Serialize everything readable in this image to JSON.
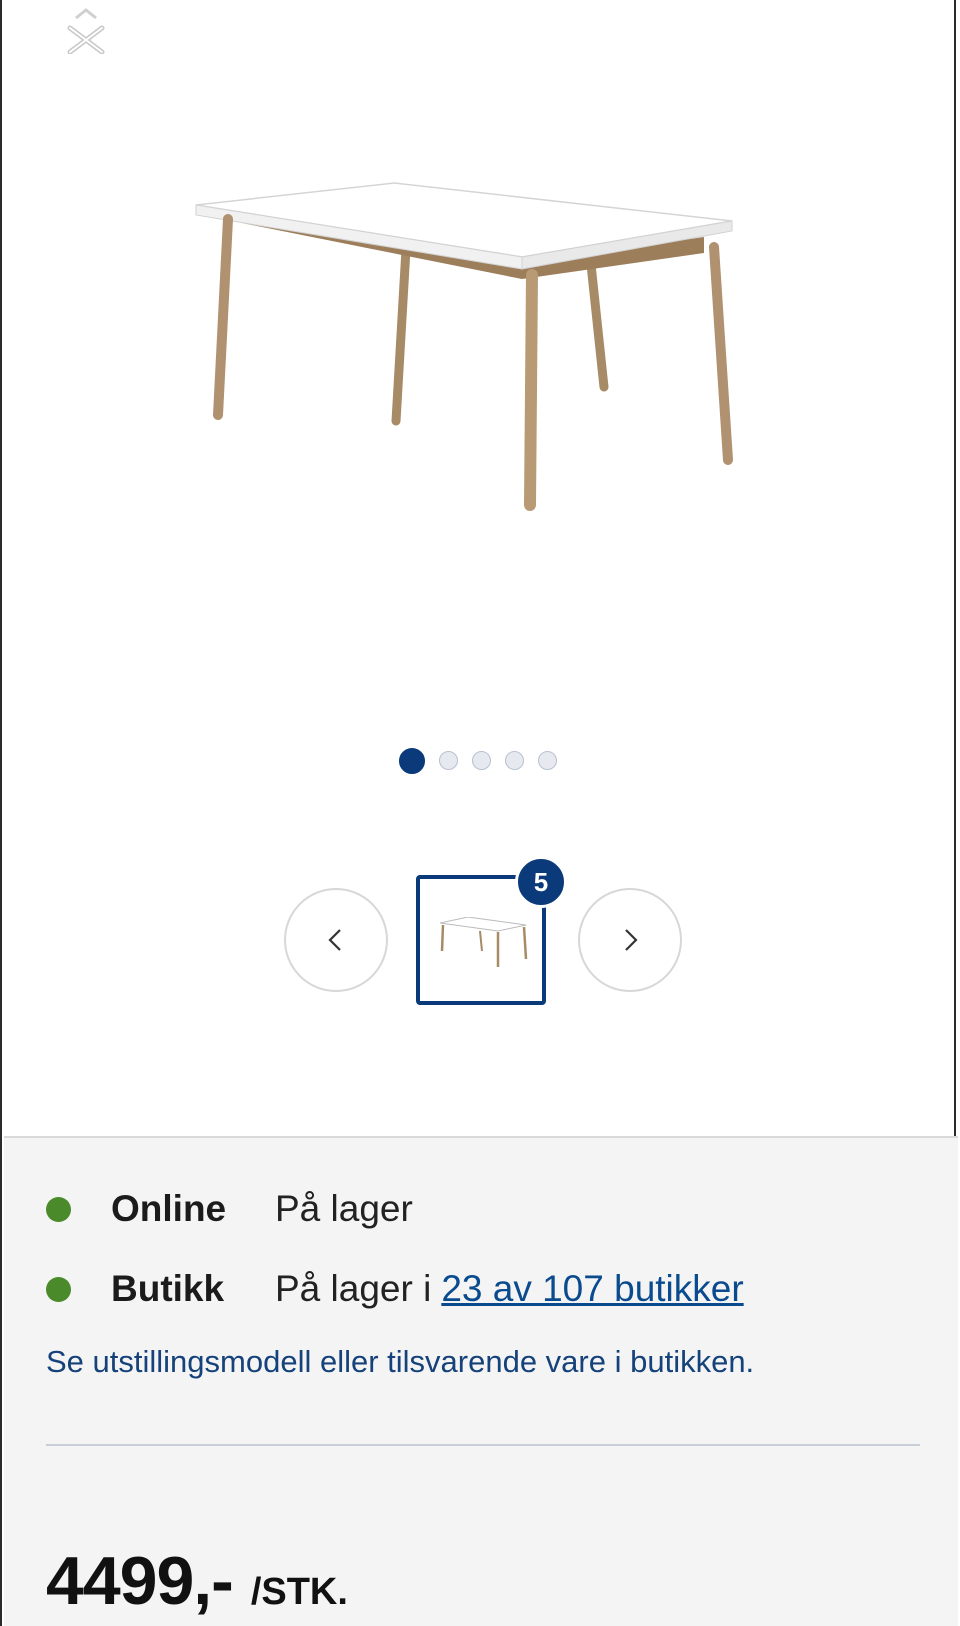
{
  "gallery": {
    "image_count": 5,
    "active_index": 0,
    "thumbnail_count_badge": "5"
  },
  "availability": {
    "online_label": "Online",
    "online_status": "På lager",
    "store_label": "Butikk",
    "store_status_prefix": "På lager i",
    "store_link": "23 av 107 butikker",
    "note": "Se utstillingsmodell eller tilsvarende vare i butikken."
  },
  "price": {
    "amount": "4499,-",
    "unit": "/STK."
  },
  "colors": {
    "accent": "#0a3a7a",
    "in_stock": "#4a8a2a",
    "link": "#0a4a8e"
  }
}
